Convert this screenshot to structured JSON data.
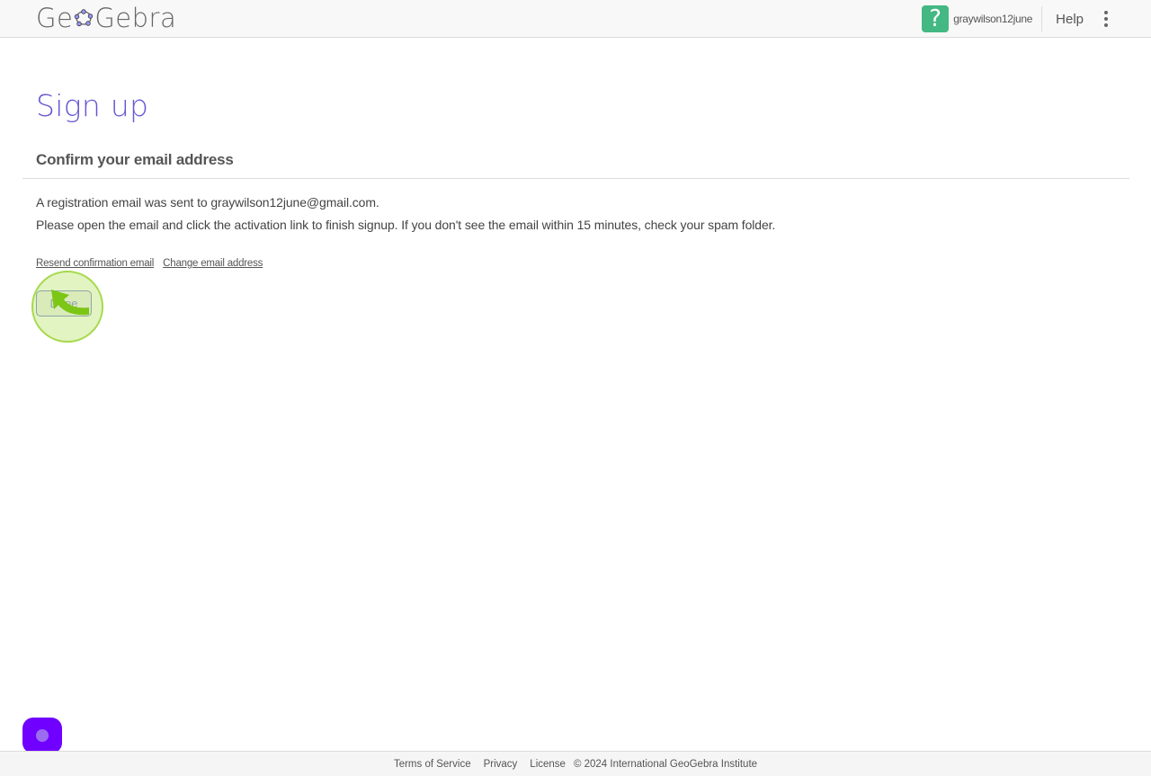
{
  "header": {
    "logo_text_left": "Ge",
    "logo_text_right": "Gebra",
    "logo_icon": "geogebra-pentagon-icon",
    "avatar_glyph": "?",
    "avatar_color": "#43b883",
    "username": "graywilson12june",
    "help_label": "Help",
    "menu_icon": "more-vertical-icon"
  },
  "main": {
    "title": "Sign up",
    "subtitle": "Confirm your email address",
    "message_line1": "A registration email was sent to graywilson12june@gmail.com.",
    "message_line2": "Please open the email and click the activation link to finish signup. If you don't see the email within 15 minutes, check your spam folder.",
    "links": {
      "resend": "Resend confirmation email",
      "change": "Change email address"
    },
    "done_button": "Done",
    "title_color": "#6557d2"
  },
  "chat_widget": {
    "icon": "chat-bubble-icon",
    "color": "#7000ff"
  },
  "footer": {
    "terms": "Terms of Service",
    "privacy": "Privacy",
    "license": "License",
    "copyright": "© 2024 International GeoGebra Institute"
  }
}
